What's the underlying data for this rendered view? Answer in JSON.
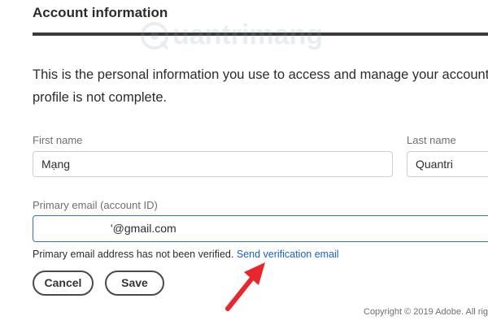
{
  "section": {
    "title": "Account information",
    "description_line1": "This is the personal information you use to access and manage your account.",
    "description_line2": "profile is not complete."
  },
  "watermark": {
    "text": "uantrimang"
  },
  "form": {
    "first_name_label": "First name",
    "first_name_value": "Mạng",
    "last_name_label": "Last name",
    "last_name_value": "Quantri",
    "email_label": "Primary email (account ID)",
    "email_value": "'@gmail.com",
    "verification_notice": "Primary email address has not been verified.",
    "verification_link": "Send verification email"
  },
  "buttons": {
    "cancel_label": "Cancel",
    "save_label": "Save"
  },
  "footer": {
    "copyright": "Copyright © 2019 Adobe. All rig"
  },
  "colors": {
    "link": "#1d5fbf",
    "focus_border": "#2d73d0",
    "arrow": "#e8262b"
  },
  "icons": {
    "watermark_logo": "quantrimang-logo",
    "annotation": "red-arrow-icon"
  }
}
